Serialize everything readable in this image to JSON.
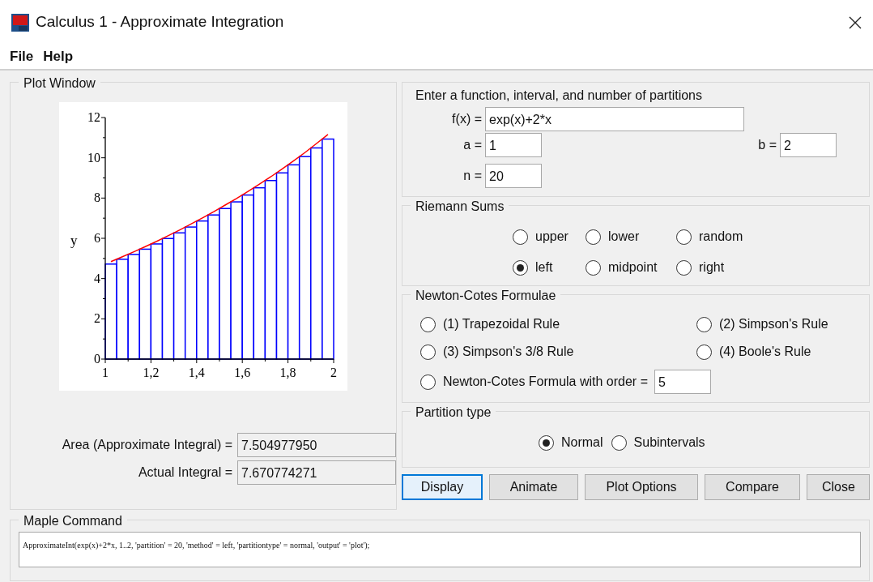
{
  "window": {
    "title": "Calculus 1 - Approximate Integration"
  },
  "menu": [
    "File",
    "Help"
  ],
  "plot_window": {
    "title": "Plot Window",
    "chart_data": {
      "type": "bar",
      "ylabel": "y",
      "x": [
        1.025,
        1.075,
        1.125,
        1.175,
        1.225,
        1.275,
        1.325,
        1.375,
        1.425,
        1.475,
        1.525,
        1.575,
        1.625,
        1.675,
        1.725,
        1.775,
        1.825,
        1.875,
        1.925,
        1.975
      ],
      "xlim": [
        1,
        2
      ],
      "ylim": [
        0,
        12
      ],
      "xticks": [
        {
          "value": 1,
          "label": "1"
        },
        {
          "value": 1.2,
          "label": "1,2"
        },
        {
          "value": 1.4,
          "label": "1,4"
        },
        {
          "value": 1.6,
          "label": "1,6"
        },
        {
          "value": 1.8,
          "label": "1,8"
        },
        {
          "value": 2,
          "label": "2"
        }
      ],
      "yticks": [
        0,
        2,
        4,
        6,
        8,
        10,
        12
      ],
      "series": [
        {
          "color": "#0000ff",
          "values": [
            4.72,
            4.96,
            5.2,
            5.46,
            5.72,
            5.99,
            6.27,
            6.56,
            6.86,
            7.16,
            7.48,
            7.81,
            8.15,
            8.51,
            8.87,
            9.25,
            9.65,
            10.06,
            10.49,
            10.93
          ]
        },
        {
          "type": "line",
          "color": "#ff0000",
          "values": [
            4.84,
            5.08,
            5.33,
            5.59,
            5.85,
            6.13,
            6.41,
            6.71,
            7.01,
            7.32,
            7.65,
            7.98,
            8.33,
            8.69,
            9.06,
            9.45,
            9.85,
            10.27,
            10.71,
            11.16
          ]
        }
      ]
    },
    "results": [
      {
        "label": "Area (Approximate Integral) =",
        "value": "7.504977950"
      },
      {
        "label": "Actual Integral =",
        "value": "7.670774271"
      }
    ]
  },
  "input_panel": {
    "title": "Enter a function, interval, and number of partitions",
    "fields": [
      {
        "label": "f(x) =",
        "value": "exp(x)+2*x"
      },
      {
        "label": "a =",
        "value": "1"
      },
      {
        "label": "b =",
        "value": "2"
      },
      {
        "label": "n =",
        "value": "20"
      }
    ]
  },
  "riemann_sums": {
    "title": "Riemann Sums",
    "options": [
      {
        "label": "upper",
        "selected": false
      },
      {
        "label": "lower",
        "selected": false
      },
      {
        "label": "random",
        "selected": false
      },
      {
        "label": "left",
        "selected": true
      },
      {
        "label": "midpoint",
        "selected": false
      },
      {
        "label": "right",
        "selected": false
      }
    ]
  },
  "newton_cotes": {
    "title": "Newton-Cotes Formulae",
    "options": [
      {
        "label": "(1) Trapezoidal Rule",
        "selected": false
      },
      {
        "label": "(2) Simpson's Rule",
        "selected": false
      },
      {
        "label": "(3) Simpson's 3/8 Rule",
        "selected": false
      },
      {
        "label": "(4) Boole's Rule",
        "selected": false
      },
      {
        "label": "Newton-Cotes Formula with order =",
        "selected": false,
        "value": "5"
      }
    ]
  },
  "partition_type": {
    "title": "Partition type",
    "options": [
      {
        "label": "Normal",
        "selected": true
      },
      {
        "label": "Subintervals",
        "selected": false
      }
    ]
  },
  "buttons": [
    {
      "label": "Display",
      "focused": true
    },
    {
      "label": "Animate",
      "focused": false
    },
    {
      "label": "Plot Options",
      "focused": false
    },
    {
      "label": "Compare",
      "focused": false
    },
    {
      "label": "Close",
      "focused": false
    }
  ],
  "maple_command": {
    "title": "Maple Command",
    "value": "ApproximateInt(exp(x)+2*x, 1..2, 'partition' = 20, 'method' = left, 'partitiontype' = normal, 'output' = 'plot');"
  }
}
